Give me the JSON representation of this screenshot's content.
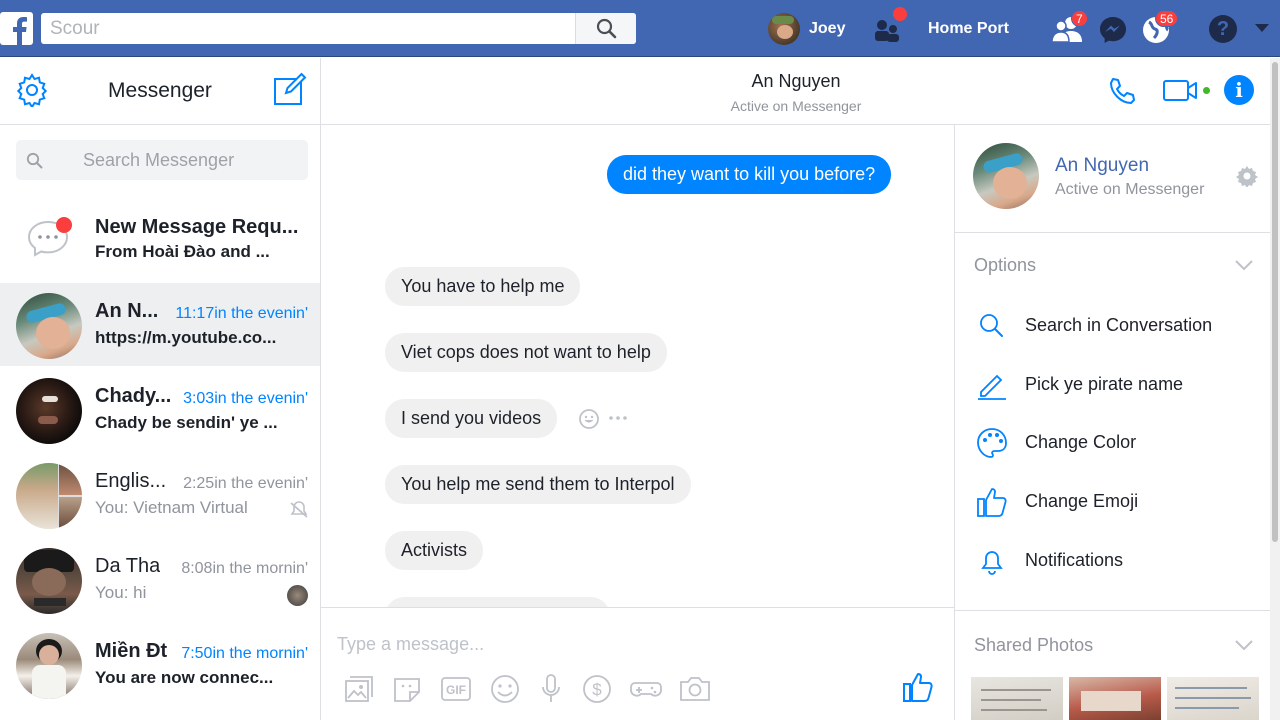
{
  "topbar": {
    "search_placeholder": "Scour",
    "profile_name": "Joey",
    "home_label": "Home Port",
    "friend_requests_count": "7",
    "notifications_count": "56"
  },
  "sidebar": {
    "title": "Messenger",
    "search_placeholder": "Search Messenger",
    "conversations": [
      {
        "name": "New Message Requ...",
        "time": "",
        "snippet": "From Hoài Đào and ...",
        "unread": true
      },
      {
        "name": "An N...",
        "time": "11:17in the evenin'",
        "snippet": "https://m.youtube.co...",
        "unread": true
      },
      {
        "name": "Chady...",
        "time": "3:03in the evenin'",
        "snippet": "Chady be sendin' ye ...",
        "unread": true
      },
      {
        "name": "Englis...",
        "time": "2:25in the evenin'",
        "snippet": "You: Vietnam Virtual",
        "unread": false
      },
      {
        "name": "Da Tha",
        "time": "8:08in the mornin'",
        "snippet": "You: hi",
        "unread": false
      },
      {
        "name": "Miền Đt",
        "time": "7:50in the mornin'",
        "snippet": "You are now connec...",
        "unread": true
      }
    ]
  },
  "chat": {
    "name": "An Nguyen",
    "status": "Active on Messenger",
    "messages": [
      {
        "text": "did they want to kill you before?",
        "direction": "out"
      },
      {
        "text": "You have to help me",
        "direction": "in"
      },
      {
        "text": "Viet cops does not want to help",
        "direction": "in"
      },
      {
        "text": "I send you videos",
        "direction": "in"
      },
      {
        "text": "You help me send them to Interpol",
        "direction": "in"
      },
      {
        "text": "Activists",
        "direction": "in"
      }
    ],
    "composer_placeholder": "Type a message..."
  },
  "info_panel": {
    "name": "An Nguyen",
    "status": "Active on Messenger",
    "options_title": "Options",
    "options": [
      {
        "label": "Search in Conversation",
        "icon": "search-icon"
      },
      {
        "label": "Pick ye pirate name",
        "icon": "pencil-icon"
      },
      {
        "label": "Change Color",
        "icon": "palette-icon"
      },
      {
        "label": "Change Emoji",
        "icon": "thumbs-up-icon"
      },
      {
        "label": "Notifications",
        "icon": "bell-icon"
      }
    ],
    "shared_photos_title": "Shared Photos"
  },
  "colors": {
    "fb_blue": "#4267b2",
    "messenger_blue": "#0084ff",
    "active_green": "#42b72a",
    "badge_red": "#fa3e3e"
  }
}
